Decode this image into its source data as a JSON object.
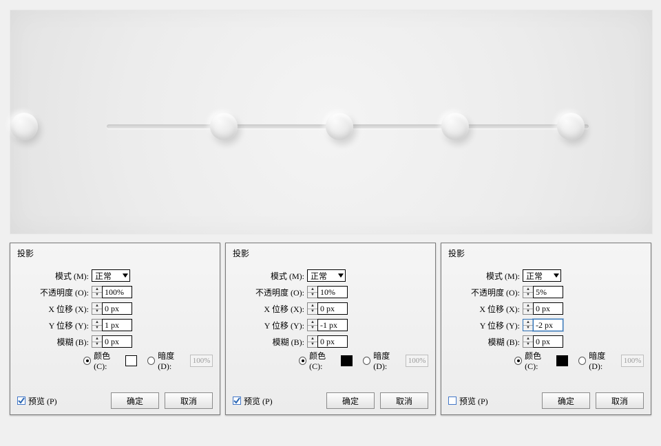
{
  "preview_alt": "Inset slider track and five neumorphic dots",
  "dialog_title": "投影",
  "labels": {
    "mode": "模式 (M):",
    "opacity": "不透明度 (O):",
    "xoff": "X 位移 (X):",
    "yoff": "Y 位移 (Y):",
    "blur": "模糊 (B):",
    "color": "颜色 (C):",
    "dark": "暗度 (D):",
    "preview_cb": "预览 (P)",
    "ok": "确定",
    "cancel": "取消",
    "mode_value": "正常",
    "dark_value": "100%"
  },
  "panels": [
    {
      "opacity": "100%",
      "x": "0 px",
      "y": "1 px",
      "blur": "0 px",
      "swatch": "#ffffff",
      "preview_checked": true,
      "y_focused": false
    },
    {
      "opacity": "10%",
      "x": "0 px",
      "y": "-1 px",
      "blur": "0 px",
      "swatch": "#000000",
      "preview_checked": true,
      "y_focused": false
    },
    {
      "opacity": "5%",
      "x": "0 px",
      "y": "-2 px",
      "blur": "0 px",
      "swatch": "#000000",
      "preview_checked": false,
      "y_focused": true
    }
  ]
}
